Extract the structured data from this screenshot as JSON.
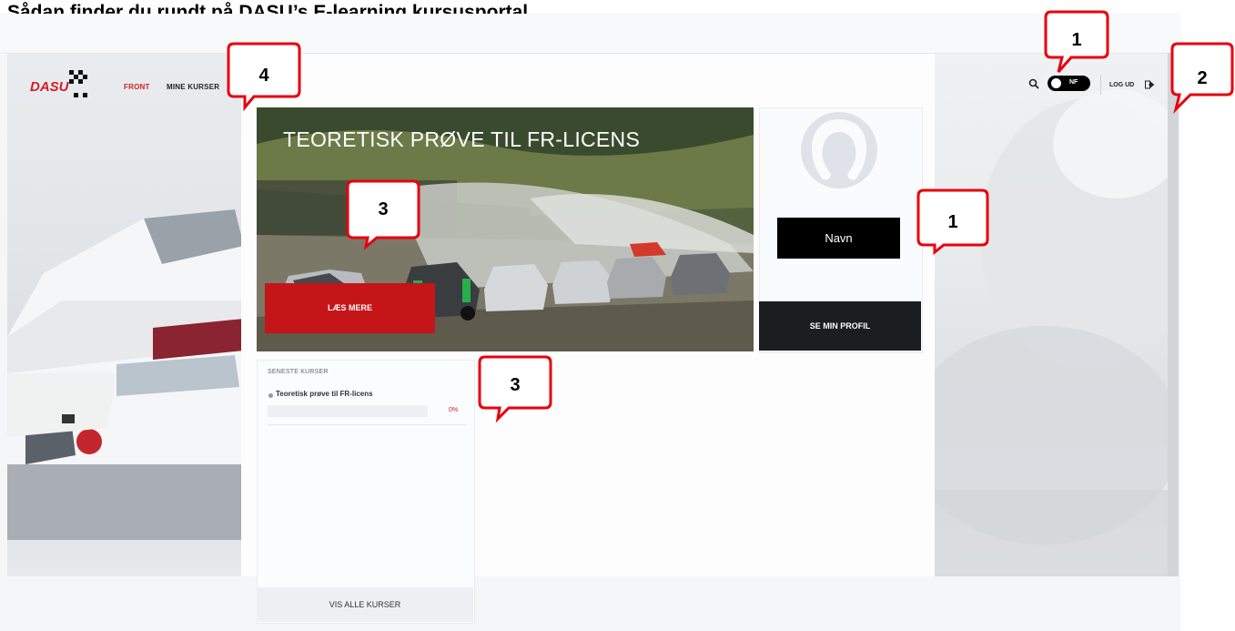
{
  "document_title": "Sådan finder du rundt på DASU’s E-learning kursusportal.",
  "nav": {
    "items": [
      "FRONT",
      "MINE KURSER"
    ],
    "active_index": 0,
    "toggle_label": "NF",
    "logout_label": "LOG UD"
  },
  "hero": {
    "title": "TEORETISK PRØVE TIL FR-LICENS",
    "button_label": "LÆS MERE"
  },
  "profile": {
    "name": "Navn",
    "button_label": "SE MIN PROFIL"
  },
  "courses": {
    "heading": "SENESTE KURSER",
    "items": [
      {
        "title": "Teoretisk prøve til FR-licens",
        "progress_percent": 0,
        "progress_label": "0%"
      }
    ],
    "show_all_label": "VIS ALLE KURSER"
  },
  "callouts": [
    "1",
    "1",
    "2",
    "3",
    "3",
    "4"
  ],
  "icons": [
    "search-icon",
    "logout-icon",
    "avatar-icon",
    "dasu-logo"
  ],
  "colors": {
    "accent_red": "#c41619",
    "callout_border": "#e8000e",
    "dark_button": "#1c1d1f"
  }
}
